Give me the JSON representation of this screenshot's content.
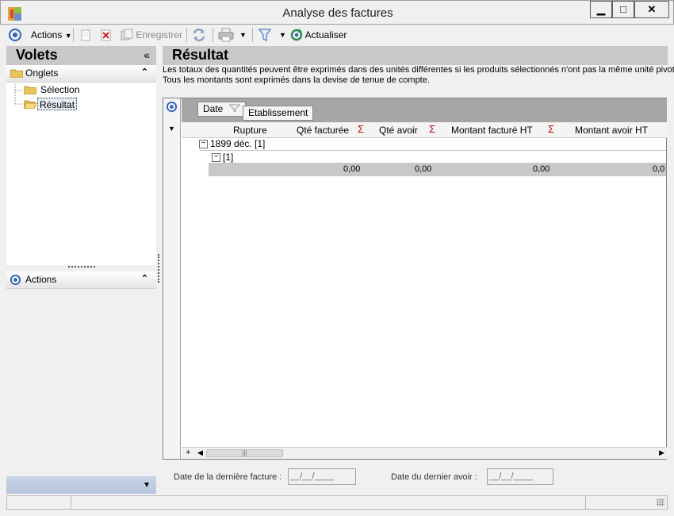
{
  "window": {
    "title": "Analyse des factures",
    "controls": {
      "minimize": "▁",
      "maximize": "□",
      "close": "✕"
    }
  },
  "toolbar": {
    "actions_label": "Actions",
    "save_label": "Enregistrer",
    "refresh_label": "Actualiser"
  },
  "left_panel": {
    "title": "Volets",
    "collapse_glyph": "«",
    "tabs_section": {
      "label": "Onglets",
      "chevron": "⌃"
    },
    "tree": [
      {
        "label": "Sélection"
      },
      {
        "label": "Résultat"
      }
    ],
    "actions_section": {
      "label": "Actions",
      "chevron": "⌃"
    },
    "bottom_chevron": "▾"
  },
  "right_panel": {
    "title": "Résultat",
    "info_lines": [
      "Les totaux des quantités peuvent être exprimés dans des unités différentes si les produits sélectionnés n'ont pas la même unité pivot.",
      "Tous les montants sont exprimés dans la devise de tenue de compte."
    ]
  },
  "grid": {
    "group_chips": [
      "Date",
      "Etablissement"
    ],
    "columns": [
      "Rupture",
      "Qté facturée",
      "Qté avoir",
      "Montant facturé HT",
      "Montant avoir HT"
    ],
    "sigma": "Σ",
    "group_rows": [
      "1899 déc. [1]",
      "[1]"
    ],
    "totals": [
      "0,00",
      "0,00",
      "0,00",
      "0,0"
    ],
    "add_glyph": "+"
  },
  "footer": {
    "last_invoice_label": "Date de la dernière facture :",
    "last_invoice_value": "__/__/____",
    "last_credit_label": "Date du dernier avoir :",
    "last_credit_value": "__/__/____"
  }
}
